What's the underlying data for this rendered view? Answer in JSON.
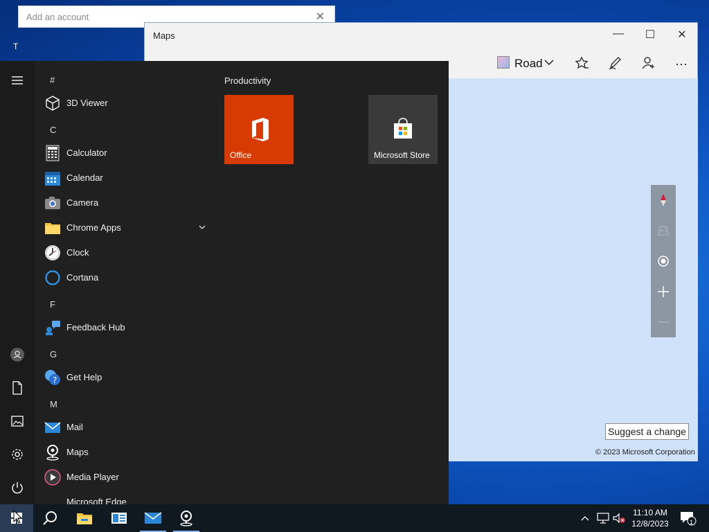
{
  "add_account": {
    "placeholder": "Add an account"
  },
  "desktop": {
    "partial_text": "T"
  },
  "maps": {
    "title": "Maps",
    "view_mode": "Road",
    "suggest_change": "Suggest a change",
    "copyright": "© 2023 Microsoft Corporation"
  },
  "start_menu": {
    "headers": {
      "hash": "#",
      "c": "C",
      "f": "F",
      "g": "G",
      "m": "M"
    },
    "apps": {
      "viewer3d": "3D Viewer",
      "calculator": "Calculator",
      "calendar": "Calendar",
      "camera": "Camera",
      "chrome_apps": "Chrome Apps",
      "clock": "Clock",
      "cortana": "Cortana",
      "feedback_hub": "Feedback Hub",
      "get_help": "Get Help",
      "mail": "Mail",
      "maps": "Maps",
      "media_player": "Media Player",
      "edge": "Microsoft Edge"
    },
    "tiles_group": "Productivity",
    "tiles": {
      "office": "Office",
      "store": "Microsoft Store"
    },
    "colors": {
      "office_tile": "#d83b01",
      "store_tile": "#3a3a3a",
      "menu_bg": "#202020"
    }
  },
  "taskbar": {
    "time": "11:10 AM",
    "date": "12/8/2023",
    "notification_count": "1"
  }
}
